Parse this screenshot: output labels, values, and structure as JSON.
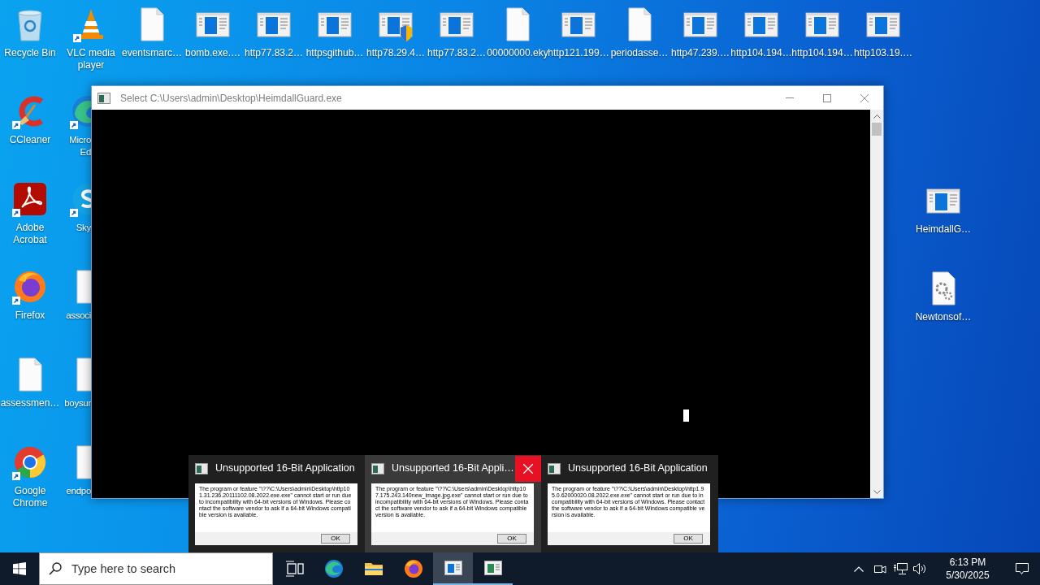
{
  "desktop": {
    "top_row": [
      {
        "label": "Recycle Bin",
        "kind": "recycle",
        "shortcut": false
      },
      {
        "label": "VLC media player",
        "kind": "vlc",
        "shortcut": true
      },
      {
        "label": "eventsmarc…",
        "kind": "file",
        "shortcut": false
      },
      {
        "label": "bomb.exe.…",
        "kind": "app",
        "shortcut": false
      },
      {
        "label": "http77.83.2…",
        "kind": "app",
        "shortcut": false
      },
      {
        "label": "httpsgithub…",
        "kind": "app",
        "shortcut": false
      },
      {
        "label": "http78.29.4…",
        "kind": "app_shield",
        "shortcut": false
      },
      {
        "label": "http77.83.2…",
        "kind": "app",
        "shortcut": false
      },
      {
        "label": "00000000.eky",
        "kind": "file",
        "shortcut": false
      },
      {
        "label": "http121.199…",
        "kind": "app",
        "shortcut": false
      },
      {
        "label": "periodasse…",
        "kind": "file",
        "shortcut": false
      },
      {
        "label": "http47.239.…",
        "kind": "app",
        "shortcut": false
      },
      {
        "label": "http104.194…",
        "kind": "app",
        "shortcut": false
      },
      {
        "label": "http104.194…",
        "kind": "app",
        "shortcut": false
      },
      {
        "label": "http103.19.…",
        "kind": "app",
        "shortcut": false
      }
    ],
    "left_column": [
      {
        "label": "CCleaner",
        "kind": "ccleaner",
        "shortcut": true
      },
      {
        "label": "Adobe Acrobat",
        "kind": "acrobat",
        "shortcut": true
      },
      {
        "label": "Firefox",
        "kind": "firefox",
        "shortcut": true
      },
      {
        "label": "assessmen…",
        "kind": "file",
        "shortcut": false
      },
      {
        "label": "Google Chrome",
        "kind": "chrome",
        "shortcut": true
      }
    ],
    "second_column": [
      {
        "label": "Micro Ed",
        "kind": "edge",
        "shortcut": true
      },
      {
        "label": "Sky",
        "kind": "skype",
        "shortcut": true
      },
      {
        "label": "associ",
        "kind": "file",
        "shortcut": false
      },
      {
        "label": "boysur",
        "kind": "file",
        "shortcut": false
      },
      {
        "label": "endpo",
        "kind": "file",
        "shortcut": false
      }
    ],
    "right_column": [
      {
        "label": "HeimdallG…",
        "kind": "app",
        "shortcut": false
      },
      {
        "label": "Newtonsof…",
        "kind": "settings_file",
        "shortcut": false
      }
    ]
  },
  "window": {
    "title": "Select C:\\Users\\admin\\Desktop\\HeimdallGuard.exe"
  },
  "thumbnails": [
    {
      "title": "Unsupported 16-Bit Application",
      "message": "The program or feature \"\\??\\C:\\Users\\admin\\Desktop\\http101.31.236.20111102.08.2022.exe.exe\" cannot start or run due to incompatibility with 64-bit versions of Windows. Please contact the software vendor to ask if a 64-bit Windows compatible version is available.",
      "button": "OK",
      "selected": false
    },
    {
      "title": "Unsupported 16-Bit Appli…",
      "message": "The program or feature \"\\??\\C:\\Users\\admin\\Desktop\\http107.175.243.140new_image.jpg.exe\" cannot start or run due to incompatibility with 64-bit versions of Windows. Please contact the software vendor to ask if a 64-bit Windows compatible version is available.",
      "button": "OK",
      "selected": true
    },
    {
      "title": "Unsupported 16-Bit Application",
      "message": "The program or feature \"\\??\\C:\\Users\\admin\\Desktop\\http1.95.0.62000020.08.2022.exe.exe\" cannot start or run due to incompatibility with 64-bit versions of Windows. Please contact the software vendor to ask if a 64-bit Windows compatible version is available.",
      "button": "OK",
      "selected": false
    }
  ],
  "taskbar": {
    "search": {
      "placeholder": "Type here to search"
    },
    "apps": [
      {
        "kind": "task_view",
        "open": false,
        "selected": false
      },
      {
        "kind": "edge",
        "open": false,
        "selected": false
      },
      {
        "kind": "explorer",
        "open": false,
        "selected": false
      },
      {
        "kind": "firefox",
        "open": false,
        "selected": false
      },
      {
        "kind": "console",
        "open": true,
        "selected": true
      },
      {
        "kind": "dialog",
        "open": true,
        "selected": false
      }
    ],
    "time": "6:13 PM",
    "date": "5/30/2025"
  }
}
